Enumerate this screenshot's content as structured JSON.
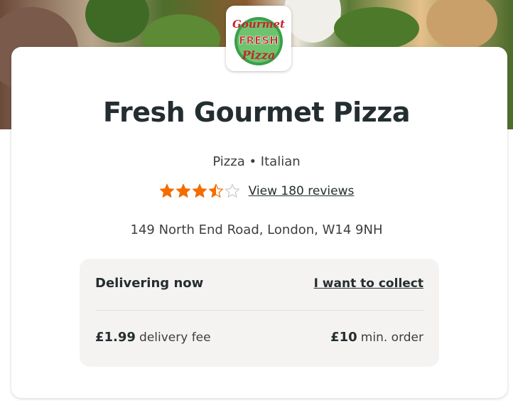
{
  "restaurant": {
    "logo_text_top": "Gourmet",
    "logo_text_mid": "FRESH",
    "logo_text_bottom": "Pizza",
    "name": "Fresh Gourmet Pizza",
    "cuisines": "Pizza • Italian",
    "rating": 3.5,
    "rating_max": 5,
    "reviews_link": "View 180 reviews",
    "address": "149 North End Road, London, W14 9NH"
  },
  "delivery": {
    "status": "Delivering now",
    "collect_link": "I want to collect",
    "fee_amount": "£1.99",
    "fee_label": "delivery fee",
    "min_amount": "£10",
    "min_label": "min. order"
  },
  "colors": {
    "star_filled": "#f36d00",
    "star_empty": "#c9c9c9",
    "text_primary": "#242e30",
    "box_bg": "#f5f3f1",
    "logo_red": "#c2272d",
    "logo_green": "#2e8b3c"
  },
  "icons": {
    "star_full": "star-icon",
    "star_half": "star-half-icon",
    "star_empty": "star-outline-icon"
  }
}
